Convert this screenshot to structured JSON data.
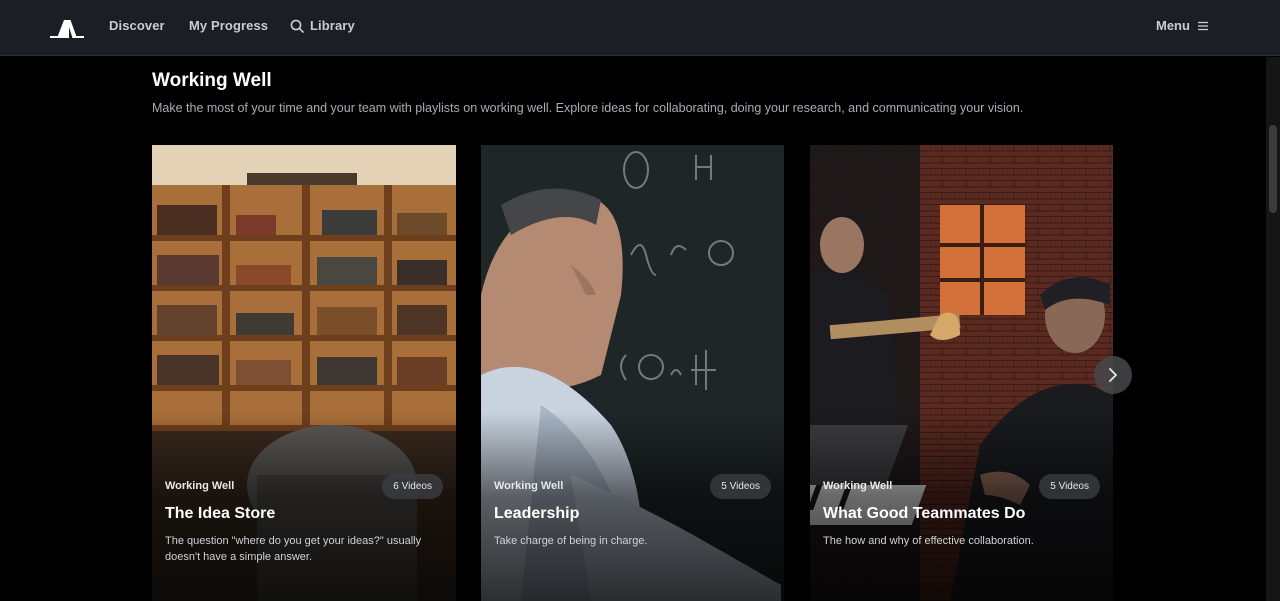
{
  "nav": {
    "links": [
      "Discover",
      "My Progress",
      "Library"
    ],
    "menu_label": "Menu",
    "logo_icon": "masterclass-logo-icon",
    "search_icon": "search-icon",
    "menu_icon": "hamburger-icon"
  },
  "section": {
    "title": "Working Well",
    "description": "Make the most of your time and your team with playlists on working well. Explore ideas for collaborating, doing your research, and communicating your vision."
  },
  "cards": [
    {
      "category": "Working Well",
      "badge": "6 Videos",
      "title": "The Idea Store",
      "description": "The question \"where do you get your ideas?\" usually doesn't have a simple answer.",
      "image": "bookshelf-library-photo"
    },
    {
      "category": "Working Well",
      "badge": "5 Videos",
      "title": "Leadership",
      "description": "Take charge of being in charge.",
      "image": "man-at-chalkboard-photo"
    },
    {
      "category": "Working Well",
      "badge": "5 Videos",
      "title": "What Good Teammates Do",
      "description": "The how and why of effective collaboration.",
      "image": "musicians-playing-photo"
    }
  ],
  "carousel": {
    "next_icon": "chevron-right-icon"
  },
  "colors": {
    "nav_bg": "#1b1e24",
    "page_bg": "#000000",
    "muted_text": "#a9acb2"
  }
}
